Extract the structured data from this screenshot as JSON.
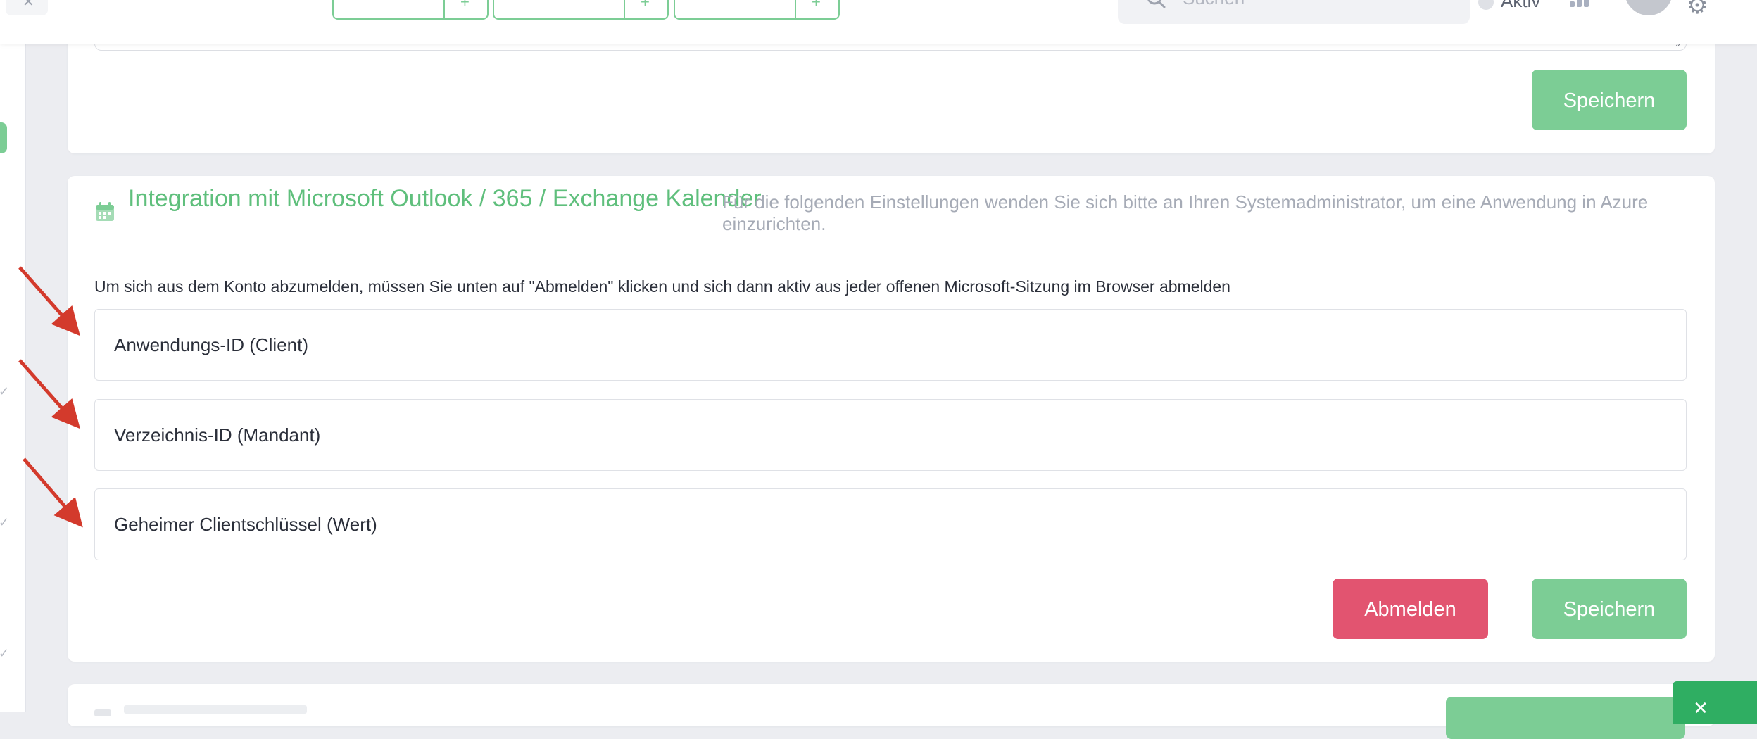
{
  "topbar": {
    "search_placeholder": "Suchen",
    "status_label": "Aktiv"
  },
  "top_card": {
    "save_label": "Speichern"
  },
  "integration": {
    "title": "Integration mit Microsoft Outlook / 365 / Exchange Kalender",
    "description": "Für die folgenden Einstellungen wenden Sie sich bitte an Ihren Systemadministrator, um eine Anwendung in Azure einzurichten.",
    "info": "Um sich aus dem Konto abzumelden, müssen Sie unten auf \"Abmelden\" klicken und sich dann aktiv aus jeder offenen Microsoft-Sitzung im Browser abmelden",
    "fields": {
      "app_id_placeholder": "Anwendungs-ID (Client)",
      "directory_id_placeholder": "Verzeichnis-ID (Mandant)",
      "secret_placeholder": "Geheimer Clientschlüssel (Wert)"
    },
    "logout_label": "Abmelden",
    "save_label": "Speichern"
  },
  "colors": {
    "accent": "#7ccd95",
    "accent_text": "#5fbf7c",
    "danger": "#e25470",
    "annotation_arrow": "#d33a2c"
  },
  "icons": {
    "calendar": "calendar-icon",
    "search": "search-icon",
    "settings": "gear-icon",
    "resize": "resize-handle-icon"
  }
}
